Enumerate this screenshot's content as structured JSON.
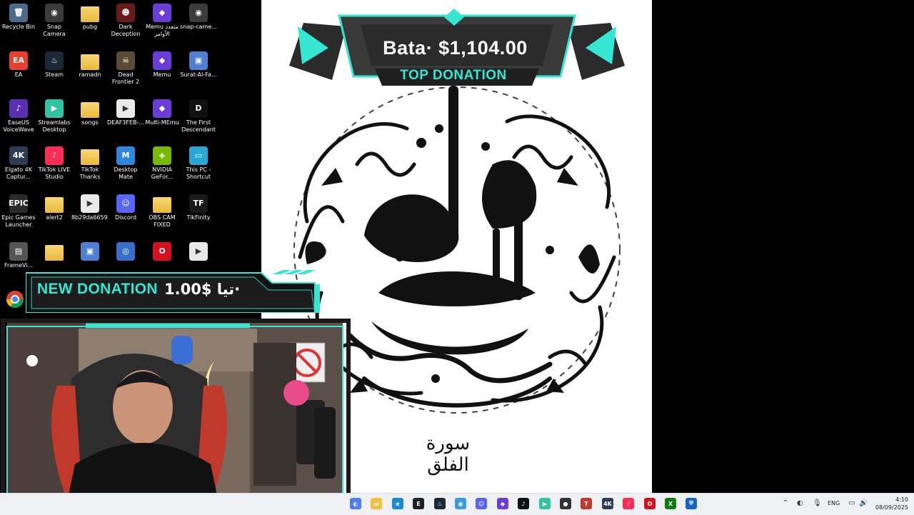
{
  "desktop": {
    "icons": [
      {
        "label": "Recycle Bin",
        "glyph": "🗑",
        "bg": "#4b6a8c"
      },
      {
        "label": "Snap Camera",
        "glyph": "◉",
        "bg": "#3b3b3b"
      },
      {
        "label": "pubg",
        "glyph": "",
        "bg": "folder"
      },
      {
        "label": "Dark Deception",
        "glyph": "☻",
        "bg": "#6b1a1a"
      },
      {
        "label": "Memu متعدد الأوامر",
        "glyph": "◆",
        "bg": "#6a3dd6"
      },
      {
        "label": "snap-came...",
        "glyph": "◉",
        "bg": "#3b3b3b"
      },
      {
        "label": "EA",
        "glyph": "EA",
        "bg": "#e8402f"
      },
      {
        "label": "Steam",
        "glyph": "♨",
        "bg": "#1b2838"
      },
      {
        "label": "ramadn",
        "glyph": "",
        "bg": "folder"
      },
      {
        "label": "Dead Frontier 2",
        "glyph": "☠",
        "bg": "#5b4a36"
      },
      {
        "label": "Memu",
        "glyph": "◆",
        "bg": "#6a3dd6"
      },
      {
        "label": "Surat-Al-Fa...",
        "glyph": "▣",
        "bg": "#4e7fd1"
      },
      {
        "label": "EaseUS VoiceWave",
        "glyph": "♪",
        "bg": "#5b2fb2"
      },
      {
        "label": "Streamlabs Desktop",
        "glyph": "▶",
        "bg": "#31c3a2"
      },
      {
        "label": "songs",
        "glyph": "",
        "bg": "folder"
      },
      {
        "label": "DEAF3FEB-...",
        "glyph": "▶",
        "bg": "#e9e9e9"
      },
      {
        "label": "Multi-MEmu",
        "glyph": "◆",
        "bg": "#6a3dd6"
      },
      {
        "label": "The First Descendant",
        "glyph": "D",
        "bg": "#111"
      },
      {
        "label": "Elgato 4K Captur...",
        "glyph": "4K",
        "bg": "#2e3b55"
      },
      {
        "label": "TikTok LIVE Studio",
        "glyph": "♪",
        "bg": "#fe2c55"
      },
      {
        "label": "TikTok Thanks",
        "glyph": "",
        "bg": "folder"
      },
      {
        "label": "Desktop Mate",
        "glyph": "M",
        "bg": "#2e86de"
      },
      {
        "label": "NVIDIA GeFor...",
        "glyph": "◈",
        "bg": "#76b900"
      },
      {
        "label": "This PC - Shortcut",
        "glyph": "▭",
        "bg": "#2aa7d9"
      },
      {
        "label": "Epic Games Launcher",
        "glyph": "EPIC",
        "bg": "#2a2a2a"
      },
      {
        "label": "alert2",
        "glyph": "",
        "bg": "folder"
      },
      {
        "label": "8b29da6659...",
        "glyph": "▶",
        "bg": "#e9e9e9"
      },
      {
        "label": "Discord",
        "glyph": "☺",
        "bg": "#5865f2"
      },
      {
        "label": "OBS CAM FIXED",
        "glyph": "",
        "bg": "folder"
      },
      {
        "label": "TikFinity",
        "glyph": "TF",
        "bg": "#1a1a1a"
      },
      {
        "label": "FrameVi...",
        "glyph": "▤",
        "bg": "#555"
      },
      {
        "label": "",
        "glyph": "",
        "bg": "folder"
      },
      {
        "label": "",
        "glyph": "▣",
        "bg": "#4e7fd1"
      },
      {
        "label": "",
        "glyph": "◎",
        "bg": "#3a6ec9"
      },
      {
        "label": "",
        "glyph": "O",
        "bg": "#d4111f"
      },
      {
        "label": "",
        "glyph": "▶",
        "bg": "#e9e9e9"
      }
    ]
  },
  "top_donation": {
    "name_amount": "Bata· $1,104.00",
    "title": "TOP DONATION"
  },
  "new_donation": {
    "title": "NEW DONATION",
    "amount": "1.00$ تيا·"
  },
  "calligraphy": {
    "surah_label": "سورة الفلق"
  },
  "colors": {
    "accent": "#35e6d2",
    "banner_dark": "#2b2b2b"
  },
  "taskbar": {
    "icons": [
      {
        "name": "copilot-icon",
        "glyph": "◐",
        "bg": "#4f7cf7"
      },
      {
        "name": "file-explorer-icon",
        "glyph": "▬",
        "bg": "#f3c13a"
      },
      {
        "name": "edge-icon",
        "glyph": "e",
        "bg": "#1a8ad4"
      },
      {
        "name": "epic-games-icon",
        "glyph": "E",
        "bg": "#222"
      },
      {
        "name": "steam-icon",
        "glyph": "♨",
        "bg": "#1b2838"
      },
      {
        "name": "chrome-icon",
        "glyph": "◉",
        "bg": "#3a9bde"
      },
      {
        "name": "discord-icon",
        "glyph": "☺",
        "bg": "#5865f2"
      },
      {
        "name": "memu-icon",
        "glyph": "◆",
        "bg": "#6a3dd6"
      },
      {
        "name": "tiktok-icon",
        "glyph": "♪",
        "bg": "#111"
      },
      {
        "name": "streamlabs-icon",
        "glyph": "▶",
        "bg": "#31c3a2"
      },
      {
        "name": "obs-icon",
        "glyph": "●",
        "bg": "#333"
      },
      {
        "name": "tikfinity-icon",
        "glyph": "T",
        "bg": "#c0392b"
      },
      {
        "name": "elgato-icon",
        "glyph": "4K",
        "bg": "#2e3b55"
      },
      {
        "name": "tiktok-live-icon",
        "glyph": "♪",
        "bg": "#fe2c55"
      },
      {
        "name": "opera-icon",
        "glyph": "O",
        "bg": "#d4111f"
      },
      {
        "name": "xbox-icon",
        "glyph": "X",
        "bg": "#107c10"
      },
      {
        "name": "defender-icon",
        "glyph": "⛨",
        "bg": "#1565c0"
      }
    ],
    "language": "ENG",
    "time": "4:10",
    "date": "08/09/2025"
  }
}
